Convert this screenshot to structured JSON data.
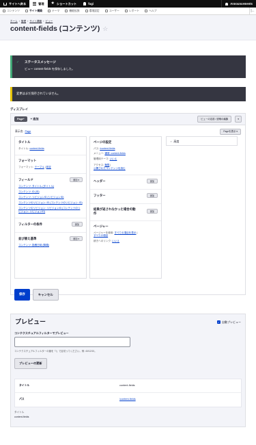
{
  "toolbar": {
    "back_label": "サイトへ戻る",
    "manage_label": "管理",
    "shortcut_label": "ショートカット",
    "user_label": "fugi",
    "announcements_label": "Announcements"
  },
  "subtray": {
    "items": [
      "コンテンツ",
      "サイト構築",
      "テーマ",
      "機能拡張",
      "環境設定",
      "ユーザー",
      "レポート",
      "ヘルプ"
    ]
  },
  "breadcrumb": [
    "ホーム",
    "管理",
    "サイト構築",
    "ビュー"
  ],
  "page_title": "content-fields (コンテンツ)",
  "messages": {
    "status_title": "ステータスメッセージ",
    "status_body": "ビュー content-fields を保存しました。",
    "warning": "変更はまだ保存されていません。"
  },
  "display": {
    "heading": "ディスプレイ",
    "tab_page": "Page*",
    "add_label": "+ 追加",
    "edit_name_label": "ビューの名前 / 説明の編集",
    "show_label": "表示名:",
    "show_value": "Page",
    "page_show_btn": "Pageを表示",
    "col1": {
      "title_section": "タイトル",
      "title_row_label": "タイトル:",
      "title_row_value": "content-fields",
      "format_section": "フォーマット",
      "format_row_label": "フォーマット:",
      "format_row_value": "テーブル",
      "format_sep": "|",
      "format_settings": "設定",
      "fields_section": "フィールド",
      "fields_btn": "追加",
      "fields": [
        "コンテンツ: タイトル (タイトル)",
        "コンテンツ: ID (ID)",
        "コンテンツ: リビジョンID (リビジョンID)",
        "コンテンツのリビジョン: ID (コンテンツのリビジョン: ID)",
        "コンテンツのリビジョン: リビジョンID (コンテンツのリビジョン: リビジョンID)"
      ],
      "filter_section": "フィルターの条件",
      "filter_btn": "追加",
      "sort_section": "並び替え基準",
      "sort_btn": "追加",
      "sort_item": "コンテンツ: 投稿日時 (降順)"
    },
    "col2": {
      "page_settings": "ページの設定",
      "path_label": "パス:",
      "path_value": "/content-fields",
      "menu_label": "メニュー:",
      "menu_value": "通常: content-fields",
      "admin_theme_label": "管理用テーマ:",
      "admin_theme_value": "いいえ",
      "access_label": "アクセス:",
      "access_value": "権限",
      "access_sep": "|",
      "access_value2": "公開されたコンテンツを読む",
      "header_section": "ヘッダー",
      "header_btn": "追加",
      "footer_section": "フッター",
      "footer_btn": "追加",
      "noresult_section": "結果が返されなかった場合の動作",
      "noresult_btn": "追加",
      "pager_section": "ページャー",
      "pager_row_label": "ページャーを使用:",
      "pager_row_value": "すべての項目を表示",
      "pager_row_sep": "|",
      "pager_row_value2": "すべての項目",
      "more_label": "続きへのリンク:",
      "more_value": "いいえ"
    },
    "advanced_label": "高度"
  },
  "actions": {
    "save": "保存",
    "cancel": "キャンセル"
  },
  "preview": {
    "title": "プレビュー",
    "auto_preview": "自動プレビュー",
    "filter_label": "コンテクスチュアルフィルターでプレビュー",
    "filter_desc": "コンテクスチュアルフィルターの値を「/」で区切ってください。例: 40/12/10。",
    "update_btn": "プレビューの更新",
    "rows": [
      {
        "key": "タイトル",
        "value": "content-fields"
      },
      {
        "key": "パス",
        "value": "/content-fields"
      }
    ],
    "footer_label": "タイトル",
    "footer_value": "content-fields"
  }
}
